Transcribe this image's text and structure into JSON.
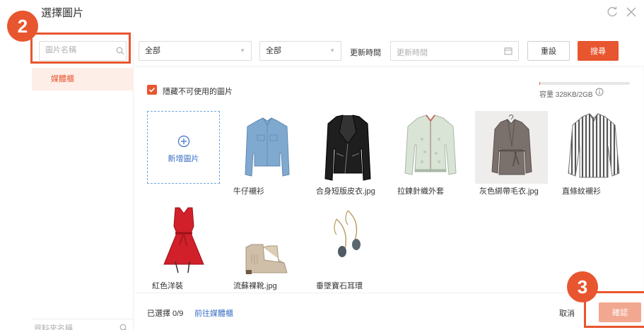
{
  "dialog": {
    "title": "選擇圖片"
  },
  "sidebar": {
    "search_placeholder": "圖片名稱",
    "items": [
      {
        "label": "媒體櫃"
      }
    ],
    "folder_search_placeholder": "資料夾名稱"
  },
  "filters": {
    "type_select": "全部",
    "status_select": "全部",
    "date_label": "更新時間",
    "date_placeholder": "更新時間",
    "reset_label": "重設",
    "search_label": "搜尋"
  },
  "options": {
    "hide_unusable_label": "隱藏不可使用的圖片",
    "hide_unusable_checked": true
  },
  "capacity": {
    "text": "容量 328KB/2GB",
    "used_fraction": 0.0002
  },
  "gallery": {
    "add_label": "新增圖片",
    "images": [
      {
        "caption": "牛仔襯衫",
        "icon": "denim-shirt-image"
      },
      {
        "caption": "合身短版皮衣.jpg",
        "icon": "leather-jacket-image"
      },
      {
        "caption": "拉鍊針織外套",
        "icon": "knit-zip-jacket-image"
      },
      {
        "caption": "灰色綁帶毛衣.jpg",
        "icon": "grey-wrap-sweater-image"
      },
      {
        "caption": "直條紋襯衫",
        "icon": "striped-shirt-image"
      },
      {
        "caption": "紅色洋裝",
        "icon": "red-dress-image"
      },
      {
        "caption": "流蘇裸靴.jpg",
        "icon": "fringe-boots-image"
      },
      {
        "caption": "垂墜寶石耳環",
        "icon": "drop-earrings-image"
      }
    ]
  },
  "footer": {
    "selected_text": "已選擇 0/9",
    "goto_link": "前往媒體櫃",
    "cancel_label": "取消",
    "confirm_label": "確認"
  },
  "annotations": {
    "step_2": "2",
    "step_3": "3"
  },
  "colors": {
    "accent": "#e8562f",
    "link": "#3a6fc4",
    "confirm_disabled": "#f2a890"
  }
}
